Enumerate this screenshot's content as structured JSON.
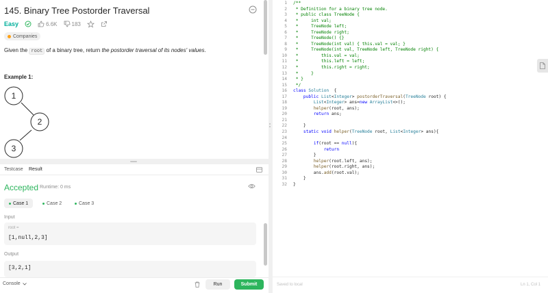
{
  "problem": {
    "title": "145. Binary Tree Postorder Traversal",
    "difficulty": "Easy",
    "likes": "6.6K",
    "dislikes": "183",
    "companies_label": "Companies",
    "statement_prefix": "Given the ",
    "statement_code": "root",
    "statement_mid": " of a binary tree, return ",
    "statement_em": "the postorder traversal of its nodes' values",
    "statement_suffix": ".",
    "example_title": "Example 1:",
    "tree_nodes": [
      "1",
      "2",
      "3"
    ]
  },
  "result_panel": {
    "tabs": [
      "Testcase",
      "Result"
    ],
    "status": "Accepted",
    "runtime": "Runtime: 0 ms",
    "cases": [
      "Case 1",
      "Case 2",
      "Case 3"
    ],
    "input_label": "Input",
    "input_var": "root =",
    "input_value": "[1,null,2,3]",
    "output_label": "Output",
    "output_value": "[3,2,1]"
  },
  "bottom_bar": {
    "console_label": "Console",
    "run_label": "Run",
    "submit_label": "Submit"
  },
  "editor": {
    "saved_status": "Saved to local",
    "cursor_position": "Ln 1, Col 1"
  },
  "code_lines": [
    [
      [
        "c",
        "/**"
      ]
    ],
    [
      [
        "c",
        " * Definition for a binary tree node."
      ]
    ],
    [
      [
        "c",
        " * public class TreeNode {"
      ]
    ],
    [
      [
        "c",
        " *     int val;"
      ]
    ],
    [
      [
        "c",
        " *     TreeNode left;"
      ]
    ],
    [
      [
        "c",
        " *     TreeNode right;"
      ]
    ],
    [
      [
        "c",
        " *     TreeNode() {}"
      ]
    ],
    [
      [
        "c",
        " *     TreeNode(int val) { this.val = val; }"
      ]
    ],
    [
      [
        "c",
        " *     TreeNode(int val, TreeNode left, TreeNode right) {"
      ]
    ],
    [
      [
        "c",
        " *         this.val = val;"
      ]
    ],
    [
      [
        "c",
        " *         this.left = left;"
      ]
    ],
    [
      [
        "c",
        " *         this.right = right;"
      ]
    ],
    [
      [
        "c",
        " *     }"
      ]
    ],
    [
      [
        "c",
        " * }"
      ]
    ],
    [
      [
        "c",
        " */"
      ]
    ],
    [
      [
        "k",
        "class "
      ],
      [
        "t",
        "Solution"
      ],
      [
        "",
        "  {"
      ]
    ],
    [
      [
        "",
        "    "
      ],
      [
        "k",
        "public "
      ],
      [
        "t",
        "List"
      ],
      [
        "",
        "<"
      ],
      [
        "t",
        "Integer"
      ],
      [
        "",
        "> "
      ],
      [
        "f",
        "postorderTraversal"
      ],
      [
        "",
        "("
      ],
      [
        "t",
        "TreeNode"
      ],
      [
        "",
        " root) {"
      ]
    ],
    [
      [
        "",
        "        "
      ],
      [
        "t",
        "List"
      ],
      [
        "",
        "<"
      ],
      [
        "t",
        "Integer"
      ],
      [
        "",
        "> ans="
      ],
      [
        "k",
        "new "
      ],
      [
        "t",
        "ArrayList"
      ],
      [
        "",
        "<>();"
      ]
    ],
    [
      [
        "",
        "        "
      ],
      [
        "f",
        "helper"
      ],
      [
        "",
        "(root, ans);"
      ]
    ],
    [
      [
        "",
        "        "
      ],
      [
        "k",
        "return"
      ],
      [
        "",
        " ans;"
      ]
    ],
    [
      [
        "",
        ""
      ]
    ],
    [
      [
        "",
        "    }"
      ]
    ],
    [
      [
        "",
        "    "
      ],
      [
        "k",
        "static void "
      ],
      [
        "f",
        "helper"
      ],
      [
        "",
        "("
      ],
      [
        "t",
        "TreeNode"
      ],
      [
        "",
        " root, "
      ],
      [
        "t",
        "List"
      ],
      [
        "",
        "<"
      ],
      [
        "t",
        "Integer"
      ],
      [
        "",
        "> ans){"
      ]
    ],
    [
      [
        "",
        ""
      ]
    ],
    [
      [
        "",
        "        "
      ],
      [
        "k",
        "if"
      ],
      [
        "",
        "(root == "
      ],
      [
        "k",
        "null"
      ],
      [
        "",
        "){"
      ]
    ],
    [
      [
        "",
        "            "
      ],
      [
        "k",
        "return"
      ],
      [
        ";"
      ]
    ],
    [
      [
        "",
        "        }"
      ]
    ],
    [
      [
        "",
        "        "
      ],
      [
        "f",
        "helper"
      ],
      [
        "",
        "(root.left, ans);"
      ]
    ],
    [
      [
        "",
        "        "
      ],
      [
        "f",
        "helper"
      ],
      [
        "",
        "(root.right, ans);"
      ]
    ],
    [
      [
        "",
        "        ans."
      ],
      [
        "f",
        "add"
      ],
      [
        "",
        "(root.val);"
      ]
    ],
    [
      [
        "",
        "    }"
      ]
    ],
    [
      [
        "",
        "}"
      ]
    ]
  ]
}
